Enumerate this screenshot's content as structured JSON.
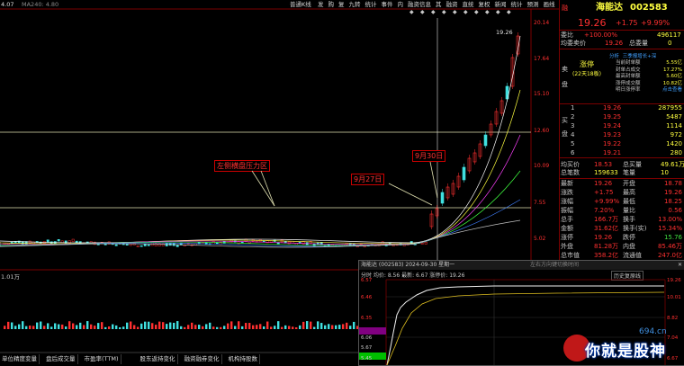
{
  "toolbar": {
    "left_label": "4.07",
    "ma_label": "MA240: 4.80",
    "items": [
      "普通K线",
      "发",
      "购",
      "复",
      "九转",
      "统计",
      "事件",
      "内",
      "融资信息",
      "其",
      "融资",
      "直统",
      "复权",
      "新闻",
      "统计",
      "预测",
      "画线",
      "更多"
    ],
    "icons": [
      "play-icon",
      "stop-icon",
      "first-icon",
      "last-icon",
      "up-icon",
      "down-icon",
      "zoom-in-icon",
      "zoom-out-icon",
      "refresh-icon",
      "close-icon"
    ]
  },
  "stock": {
    "name": "海能达",
    "code": "002583",
    "price": "19.26",
    "change": "+1.75",
    "change_pct": "+9.99%",
    "flag": "融",
    "weibi_label": "委比",
    "weibi": "+100.00%",
    "weicha": "496117",
    "avg_label": "均委卖价",
    "avg_price": "19.26",
    "total_sell_label": "总委量",
    "total_sell": "0"
  },
  "sell_box": {
    "side_label": "卖盘",
    "status": "涨停",
    "days": "(22天18板)",
    "tag1": "分析",
    "tag2": "三季报增长+深",
    "lines": [
      {
        "label": "当前封单额",
        "value": "5.55亿"
      },
      {
        "label": "封单占成交",
        "value": "17.27%"
      },
      {
        "label": "最高封单额",
        "value": "5.60亿"
      },
      {
        "label": "涨停成交额",
        "value": "10.82亿"
      },
      {
        "label": "明日涨停率",
        "value": "点击查看"
      }
    ]
  },
  "buy": {
    "side_label": "买盘",
    "rows": [
      {
        "n": "1",
        "price": "19.26",
        "vol": "287955"
      },
      {
        "n": "2",
        "price": "19.25",
        "vol": "5487"
      },
      {
        "n": "3",
        "price": "19.24",
        "vol": "1114"
      },
      {
        "n": "4",
        "price": "19.23",
        "vol": "972"
      },
      {
        "n": "5",
        "price": "19.22",
        "vol": "1420"
      },
      {
        "n": "6",
        "price": "19.21",
        "vol": "280"
      }
    ]
  },
  "stats": {
    "row1": [
      {
        "label": "均买价",
        "value": "18.53"
      },
      {
        "label": "总买量",
        "value": "49.61万"
      }
    ],
    "row2": [
      {
        "label": "总笔数",
        "value": "159633"
      },
      {
        "label": "笔量",
        "value": "10"
      }
    ],
    "grid": [
      {
        "l1": "最新",
        "v1": "19.26",
        "l2": "开盘",
        "v2": "18.78"
      },
      {
        "l1": "涨跌",
        "v1": "+1.75",
        "l2": "最高",
        "v2": "19.26"
      },
      {
        "l1": "涨幅",
        "v1": "+9.99%",
        "l2": "最低",
        "v2": "18.25"
      },
      {
        "l1": "振幅",
        "v1": "7.20%",
        "l2": "量比",
        "v2": "0.56"
      },
      {
        "l1": "总手",
        "v1": "166.7万",
        "l2": "换手",
        "v2": "13.00%"
      },
      {
        "l1": "金额",
        "v1": "31.62亿",
        "l2": "换手(实)",
        "v2": "15.34%"
      },
      {
        "l1": "涨停",
        "v1": "19.26",
        "l2": "跌停",
        "v2": "15.76"
      },
      {
        "l1": "外盘",
        "v1": "81.28万",
        "l2": "内盘",
        "v2": "85.46万"
      },
      {
        "l1": "总市值",
        "v1": "358.2亿",
        "l2": "流通值",
        "v2": "247.0亿"
      }
    ]
  },
  "chart": {
    "y_ticks": [
      "20.14",
      "17.64",
      "15.10",
      "12.60",
      "10.09",
      "7.55",
      "5.02"
    ],
    "high_label": "19.26",
    "annotations": [
      "左侧横盘压力区",
      "9月27日",
      "9月30日"
    ],
    "vol_label": "1.01万"
  },
  "bottom_tabs": [
    "单位精度变量",
    "盘后成交量",
    "市盈率(TTM)",
    "股东返持变化",
    "融资融券变化",
    "机构持股数"
  ],
  "popup": {
    "title": "海能达 (002583) 2024-09-30 星期一",
    "subtitle": "左右方向键切换时间",
    "header": "分时 均价: 8.56  最新: 6.67  涨停价: 19.26",
    "history": "历史复原线",
    "left_ticks": [
      "6.57",
      "6.46",
      "6.35",
      "6.06",
      "5.67",
      "5.45"
    ],
    "right_ticks": [
      "19.26",
      "10.01",
      "8.82",
      "7.04",
      "6.67"
    ]
  },
  "watermark": {
    "site": "694.cn",
    "text": "你就是股神"
  }
}
